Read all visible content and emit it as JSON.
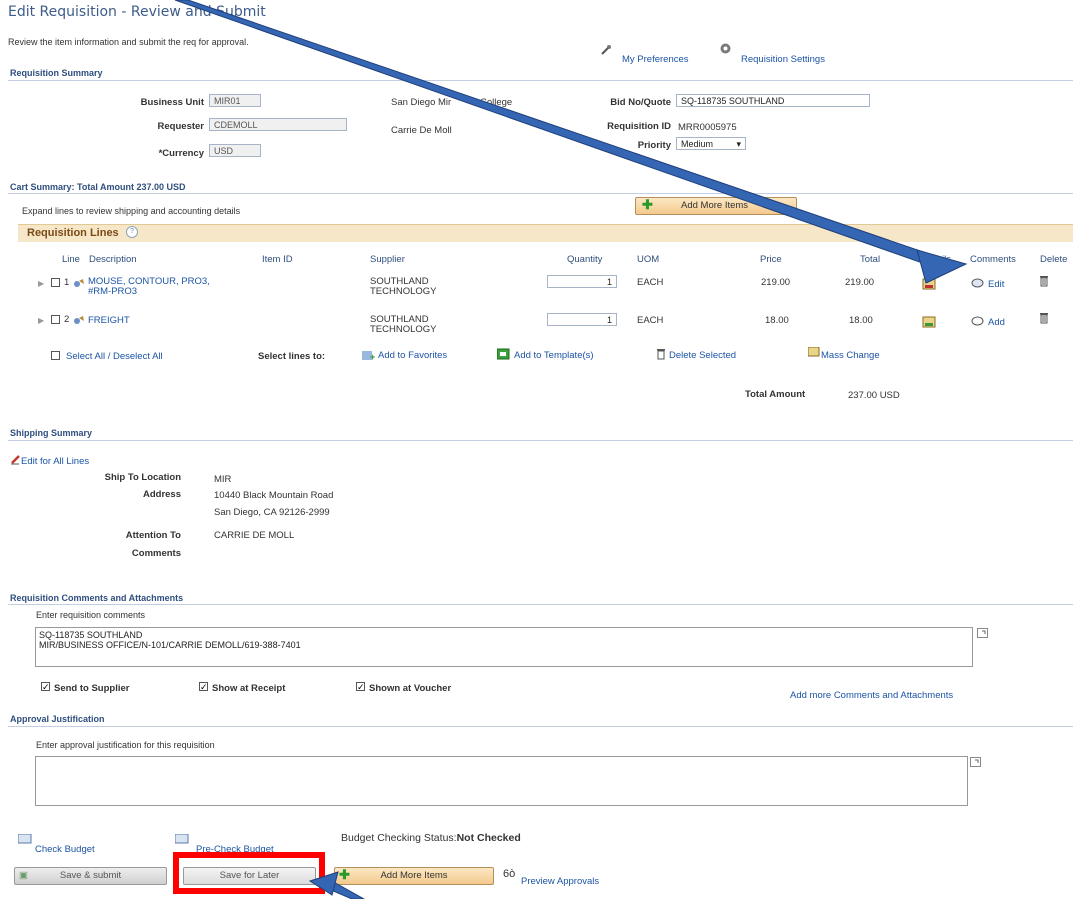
{
  "page": {
    "title": "Edit Requisition  - Review and Submit",
    "instructions": "Review the item information and submit the req for approval.",
    "my_preferences": "My Preferences",
    "requisition_settings": "Requisition Settings"
  },
  "summary": {
    "section_title": "Requisition Summary",
    "business_unit_label": "Business Unit",
    "business_unit": "MIR01",
    "business_unit_desc": "San Diego Mir",
    "business_unit_desc_tail": "College",
    "requester_label": "Requester",
    "requester": "CDEMOLL",
    "requester_name": "Carrie De Moll",
    "currency_label": "*Currency",
    "currency": "USD",
    "bid_label": "Bid No/Quote",
    "bid_value": "SQ-118735 SOUTHLAND",
    "req_id_label": "Requisition ID",
    "req_id": "MRR0005975",
    "priority_label": "Priority",
    "priority": "Medium"
  },
  "cart": {
    "section_title": "Cart Summary: Total Amount 237.00 USD",
    "expand_text": "Expand lines to review shipping and accounting details",
    "add_more_items": "Add More Items",
    "lines_title": "Requisition Lines",
    "columns": {
      "line": "Line",
      "description": "Description",
      "item_id": "Item ID",
      "supplier": "Supplier",
      "quantity": "Quantity",
      "uom": "UOM",
      "price": "Price",
      "total": "Total",
      "details": "Details",
      "comments": "Comments",
      "delete": "Delete"
    },
    "rows": [
      {
        "line": "1",
        "desc1": "MOUSE, CONTOUR, PRO3,",
        "desc2": "#RM-PRO3",
        "sup1": "SOUTHLAND",
        "sup2": "TECHNOLOGY",
        "qty": "1",
        "uom": "EACH",
        "price": "219.00",
        "total": "219.00",
        "comment": "Edit"
      },
      {
        "line": "2",
        "desc1": "FREIGHT",
        "desc2": "",
        "sup1": "SOUTHLAND",
        "sup2": "TECHNOLOGY",
        "qty": "1",
        "uom": "EACH",
        "price": "18.00",
        "total": "18.00",
        "comment": "Add"
      }
    ],
    "select_all": "Select All / Deselect All",
    "select_lines_to": "Select lines to:",
    "add_favorites": "Add to Favorites",
    "add_template": "Add to Template(s)",
    "delete_selected": "Delete Selected",
    "mass_change": "Mass Change",
    "total_amount_label": "Total Amount",
    "total_amount": "237.00 USD"
  },
  "shipping": {
    "section_title": "Shipping Summary",
    "edit_all": "Edit for All Lines",
    "ship_to_label": "Ship To Location",
    "ship_to": "MIR",
    "address_label": "Address",
    "address1": "10440 Black Mountain Road",
    "address2": "San Diego, CA  92126-2999",
    "attention_label": "Attention To",
    "attention": "CARRIE DE MOLL",
    "comments_label": "Comments"
  },
  "comments": {
    "section_title": "Requisition Comments and Attachments",
    "prompt": "Enter requisition comments",
    "line1": "SQ-118735 SOUTHLAND",
    "line2": "MIR/BUSINESS OFFICE/N-101/CARRIE DEMOLL/619-388-7401",
    "send_to_supplier": "Send to Supplier",
    "show_at_receipt": "Show at Receipt",
    "shown_at_voucher": "Shown at Voucher",
    "add_more": "Add more Comments and Attachments"
  },
  "approval": {
    "section_title": "Approval Justification",
    "prompt": "Enter approval justification for this requisition"
  },
  "footer": {
    "check_budget": "Check Budget",
    "pre_check_budget": "Pre-Check Budget",
    "budget_status_label": "Budget Checking Status:",
    "budget_status": "Not Checked",
    "save_submit": "Save & submit",
    "save_later": "Save for Later",
    "add_more_items": "Add More Items",
    "preview_approvals": "Preview Approvals"
  }
}
